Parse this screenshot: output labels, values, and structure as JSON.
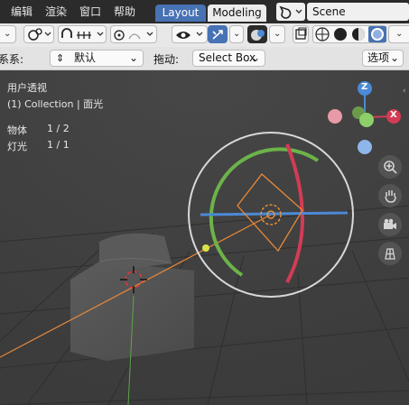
{
  "menu": {
    "edit": "编辑",
    "render": "渲染",
    "window": "窗口",
    "help": "帮助"
  },
  "workspaces": {
    "layout": "Layout",
    "modeling": "Modeling"
  },
  "scene": {
    "name": "Scene"
  },
  "header": {
    "coord_label": "系系:",
    "coord_value": "默认",
    "drag_label": "拖动:",
    "drag_value": "Select Box",
    "options_label": "选项"
  },
  "viewport": {
    "view_name": "用户透视",
    "collection_info": "(1) Collection | 面光",
    "objects_label": "物体",
    "objects_value": "1 / 2",
    "lights_label": "灯光",
    "lights_value": "1 / 1"
  },
  "gizmo": {
    "z": "Z",
    "x": "X"
  },
  "colors": {
    "accent": "#4772b3",
    "x_axis": "#d23c55",
    "y_axis": "#6cb34a",
    "z_axis": "#4b8ad6",
    "light": "#e8883a",
    "selection": "#ff9b33"
  },
  "icons": [
    "blender-scene-icon",
    "transform-orientation-icon",
    "proportional-edit-icon",
    "snap-icon",
    "pivot-icon",
    "falloff-icon",
    "visibility-icon",
    "gizmo-icon",
    "overlay-icon",
    "xray-icon",
    "wireframe-shading-icon",
    "solid-shading-icon",
    "material-shading-icon",
    "rendered-shading-icon",
    "zoom-icon",
    "pan-icon",
    "camera-icon",
    "grid-view-icon"
  ]
}
